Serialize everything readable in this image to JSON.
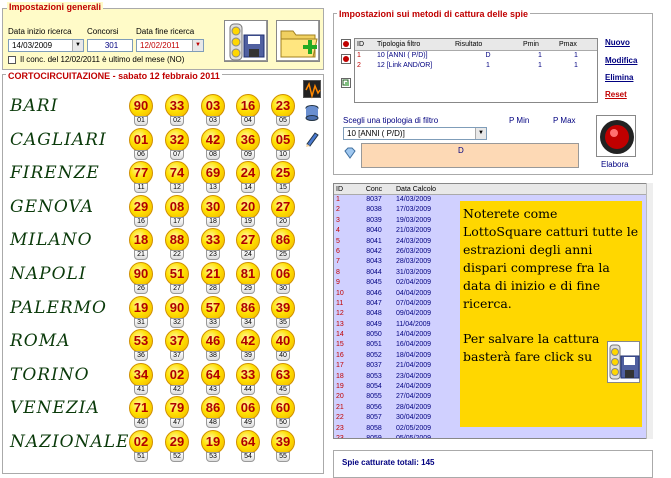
{
  "general": {
    "title": "Impostazioni generali",
    "start_label": "Data inizio ricerca",
    "start_value": "14/03/2009",
    "concorsi_label": "Concorsi",
    "concorsi_value": "301",
    "end_label": "Data fine ricerca",
    "end_value": "12/02/2011",
    "checkbox_label": "Il conc. del 12/02/2011 è ultimo del mese (NO)"
  },
  "lotto": {
    "title": "CORTOCIRCUITAZIONE - sabato 12 febbraio 2011",
    "wheels": [
      {
        "city": "BARI",
        "balls": [
          {
            "n": "90",
            "p": "01"
          },
          {
            "n": "33",
            "p": "02"
          },
          {
            "n": "03",
            "p": "03"
          },
          {
            "n": "16",
            "p": "04"
          },
          {
            "n": "23",
            "p": "05"
          }
        ]
      },
      {
        "city": "CAGLIARI",
        "balls": [
          {
            "n": "01",
            "p": "06"
          },
          {
            "n": "32",
            "p": "07"
          },
          {
            "n": "42",
            "p": "08"
          },
          {
            "n": "36",
            "p": "09"
          },
          {
            "n": "05",
            "p": "10"
          }
        ]
      },
      {
        "city": "FIRENZE",
        "balls": [
          {
            "n": "77",
            "p": "11"
          },
          {
            "n": "74",
            "p": "12"
          },
          {
            "n": "69",
            "p": "13"
          },
          {
            "n": "24",
            "p": "14"
          },
          {
            "n": "25",
            "p": "15"
          }
        ]
      },
      {
        "city": "GENOVA",
        "balls": [
          {
            "n": "29",
            "p": "16"
          },
          {
            "n": "08",
            "p": "17"
          },
          {
            "n": "30",
            "p": "18"
          },
          {
            "n": "20",
            "p": "19"
          },
          {
            "n": "27",
            "p": "20"
          }
        ]
      },
      {
        "city": "MILANO",
        "balls": [
          {
            "n": "18",
            "p": "21"
          },
          {
            "n": "88",
            "p": "22"
          },
          {
            "n": "33",
            "p": "23"
          },
          {
            "n": "27",
            "p": "24"
          },
          {
            "n": "86",
            "p": "25"
          }
        ]
      },
      {
        "city": "NAPOLI",
        "balls": [
          {
            "n": "90",
            "p": "26"
          },
          {
            "n": "51",
            "p": "27"
          },
          {
            "n": "21",
            "p": "28"
          },
          {
            "n": "81",
            "p": "29"
          },
          {
            "n": "06",
            "p": "30"
          }
        ]
      },
      {
        "city": "PALERMO",
        "balls": [
          {
            "n": "19",
            "p": "31"
          },
          {
            "n": "90",
            "p": "32"
          },
          {
            "n": "57",
            "p": "33"
          },
          {
            "n": "86",
            "p": "34"
          },
          {
            "n": "39",
            "p": "35"
          }
        ]
      },
      {
        "city": "ROMA",
        "balls": [
          {
            "n": "53",
            "p": "36"
          },
          {
            "n": "37",
            "p": "37"
          },
          {
            "n": "46",
            "p": "38"
          },
          {
            "n": "42",
            "p": "39"
          },
          {
            "n": "40",
            "p": "40"
          }
        ]
      },
      {
        "city": "TORINO",
        "balls": [
          {
            "n": "34",
            "p": "41"
          },
          {
            "n": "02",
            "p": "42"
          },
          {
            "n": "64",
            "p": "43"
          },
          {
            "n": "33",
            "p": "44"
          },
          {
            "n": "63",
            "p": "45"
          }
        ]
      },
      {
        "city": "VENEZIA",
        "balls": [
          {
            "n": "71",
            "p": "46"
          },
          {
            "n": "79",
            "p": "47"
          },
          {
            "n": "86",
            "p": "48"
          },
          {
            "n": "06",
            "p": "49"
          },
          {
            "n": "60",
            "p": "50"
          }
        ]
      },
      {
        "city": "NAZIONALE",
        "balls": [
          {
            "n": "02",
            "p": "51"
          },
          {
            "n": "29",
            "p": "52"
          },
          {
            "n": "19",
            "p": "53"
          },
          {
            "n": "64",
            "p": "54"
          },
          {
            "n": "39",
            "p": "55"
          }
        ]
      }
    ]
  },
  "methods": {
    "title": "Impostazioni sui metodi di cattura delle spie",
    "columns": [
      "ID",
      "Tipologia filtro",
      "Risultato",
      "Pmin",
      "Pmax"
    ],
    "rows": [
      [
        "1",
        "10 [ANNI ( P/D)]",
        "D",
        "1",
        "1"
      ],
      [
        "2",
        "12 [Link AND/OR]",
        "1",
        "1",
        "1"
      ]
    ],
    "links": {
      "nuovo": "Nuovo",
      "modifica": "Modifica",
      "elimina": "Elimina",
      "reset": "Reset"
    },
    "filter_label": "Scegli una tipologia di filtro",
    "pmin_label": "P Min",
    "pmax_label": "P Max",
    "filter_value": "10 [ANNI ( P/D)]",
    "input_value": "D",
    "elabora_label": "Elabora"
  },
  "list": {
    "columns": [
      "ID",
      "Conc",
      "Data Calcolo"
    ],
    "rows": [
      [
        "1",
        "8037",
        "14/03/2009"
      ],
      [
        "2",
        "8038",
        "17/03/2009"
      ],
      [
        "3",
        "8039",
        "19/03/2009"
      ],
      [
        "4",
        "8040",
        "21/03/2009"
      ],
      [
        "5",
        "8041",
        "24/03/2009"
      ],
      [
        "6",
        "8042",
        "26/03/2009"
      ],
      [
        "7",
        "8043",
        "28/03/2009"
      ],
      [
        "8",
        "8044",
        "31/03/2009"
      ],
      [
        "9",
        "8045",
        "02/04/2009"
      ],
      [
        "10",
        "8046",
        "04/04/2009"
      ],
      [
        "11",
        "8047",
        "07/04/2009"
      ],
      [
        "12",
        "8048",
        "09/04/2009"
      ],
      [
        "13",
        "8049",
        "11/04/2009"
      ],
      [
        "14",
        "8050",
        "14/04/2009"
      ],
      [
        "15",
        "8051",
        "16/04/2009"
      ],
      [
        "16",
        "8052",
        "18/04/2009"
      ],
      [
        "17",
        "8037",
        "21/04/2009"
      ],
      [
        "18",
        "8053",
        "23/04/2009"
      ],
      [
        "19",
        "8054",
        "24/04/2009"
      ],
      [
        "20",
        "8055",
        "27/04/2009"
      ],
      [
        "21",
        "8056",
        "28/04/2009"
      ],
      [
        "22",
        "8057",
        "30/04/2009"
      ],
      [
        "23",
        "8058",
        "02/05/2009"
      ],
      [
        "23",
        "8059",
        "05/05/2009"
      ]
    ]
  },
  "note": {
    "line1": "Noterete come LottoSquare catturi tutte le estrazioni degli anni dispari comprese fra la data di inizio e di fine ricerca.",
    "line2": "Per salvare la cattura basterà fare click su"
  },
  "summary": {
    "text": "Spie catturate totali: 145"
  },
  "colors": {
    "accent": "#c00000",
    "list_bg": "#d0d0ff",
    "note_bg": "#ffd700",
    "panel_bg": "#fffbc8"
  }
}
